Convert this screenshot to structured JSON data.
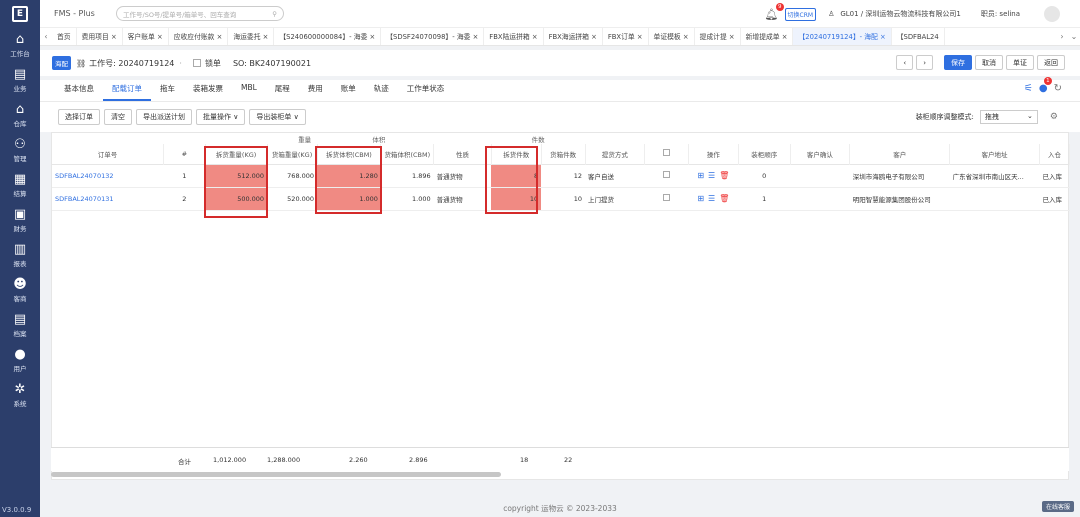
{
  "app": {
    "title": "FMS - Plus",
    "version": "V3.0.0.9",
    "copyright": "copyright 运物云 © 2023-2033",
    "online_service": "在线客服"
  },
  "sidebar": {
    "logo": "E",
    "items": [
      {
        "label": "工作台",
        "icon": "home-icon",
        "glyph": "⌂"
      },
      {
        "label": "业务",
        "icon": "list-icon",
        "glyph": "▤"
      },
      {
        "label": "仓库",
        "icon": "warehouse-icon",
        "glyph": "⌂"
      },
      {
        "label": "管理",
        "icon": "manage-icon",
        "glyph": "⚇"
      },
      {
        "label": "结算",
        "icon": "calculator-icon",
        "glyph": "▦"
      },
      {
        "label": "财务",
        "icon": "finance-icon",
        "glyph": "▣"
      },
      {
        "label": "报表",
        "icon": "chart-icon",
        "glyph": "▥"
      },
      {
        "label": "客商",
        "icon": "customers-icon",
        "glyph": "☻"
      },
      {
        "label": "档案",
        "icon": "archive-icon",
        "glyph": "▤"
      },
      {
        "label": "用户",
        "icon": "user-icon",
        "glyph": "●"
      },
      {
        "label": "系统",
        "icon": "settings-icon",
        "glyph": "✲"
      }
    ]
  },
  "topbar": {
    "search_placeholder": "工作号/SO号/提单号/箱单号、回车查询",
    "bell_count": "9",
    "crm": "切换CRM",
    "company": "GL01 / 深圳运物云物流科技有限公司1",
    "role": "职员: selina"
  },
  "tabs": [
    "首页",
    "费用项目 ×",
    "客户账单 ×",
    "应收应付账款 ×",
    "海运委托 ×",
    "【S240600000084】- 海委 ×",
    "【SDSF24070098】- 海委 ×",
    "FBX陆运拼箱 ×",
    "FBX海运拼箱 ×",
    "FBX订单 ×",
    "单证模板 ×",
    "提成计提 ×",
    "新增提成单 ×",
    "【20240719124】- 海配 ×",
    "【SDFBAL24"
  ],
  "header": {
    "tag": "海配",
    "job_label": "工作号: 20240719124",
    "lock_label": "锁单",
    "so_label": "SO: BK2407190021",
    "buttons": [
      "保存",
      "取消",
      "单证",
      "返回"
    ]
  },
  "subtabs": [
    "基本信息",
    "配载订单",
    "拖车",
    "装箱发票",
    "MBL",
    "尾程",
    "费用",
    "账单",
    "轨迹",
    "工作单状态"
  ],
  "toolbar": {
    "buttons": [
      "选择订单",
      "清空",
      "导出派送计划",
      "批量操作 ∨",
      "导出装柜单 ∨"
    ],
    "mode_label": "装柜顺序调整模式:",
    "mode_value": "拖拽"
  },
  "table": {
    "group_headers": {
      "weight": "重量",
      "volume": "体积",
      "pieces": "件数"
    },
    "columns": [
      "订单号",
      "#",
      "拆货重量(KG)",
      "货箱重量(KG)",
      "拆货体积(CBM)",
      "货箱体积(CBM)",
      "性质",
      "拆货件数",
      "货箱件数",
      "提货方式",
      "",
      "操作",
      "装柜顺序",
      "客户确认",
      "客户",
      "客户地址",
      "入仓"
    ],
    "rows": [
      {
        "order": "SDFBAL24070132",
        "idx": "1",
        "split_w": "512.000",
        "box_w": "768.000",
        "split_v": "1.280",
        "box_v": "1.896",
        "nature": "普通货物",
        "split_p": "8",
        "box_p": "12",
        "pickup": "客户自送",
        "seq": "0",
        "customer": "深圳市海鸥电子有限公司",
        "address": "广东省深圳市南山区天...",
        "warehouse": "已入库"
      },
      {
        "order": "SDFBAL24070131",
        "idx": "2",
        "split_w": "500.000",
        "box_w": "520.000",
        "split_v": "1.000",
        "box_v": "1.000",
        "nature": "普通货物",
        "split_p": "10",
        "box_p": "10",
        "pickup": "上门提货",
        "seq": "1",
        "customer": "明阳智慧能源集团股份公司",
        "address": "",
        "warehouse": "已入库"
      }
    ],
    "totals": {
      "label": "合计",
      "split_w": "1,012.000",
      "box_w": "1,288.000",
      "split_v": "2.260",
      "box_v": "2.896",
      "split_p": "18",
      "box_p": "22"
    }
  },
  "colors": {
    "sidebar": "#2c3e6b",
    "accent": "#2f6fe0",
    "highlight": "#f08a83",
    "annotation": "#d42b2b"
  }
}
